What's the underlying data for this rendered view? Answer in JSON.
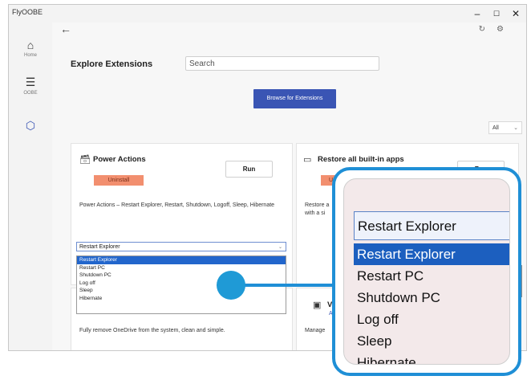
{
  "window": {
    "title": "FlyOOBE",
    "controls": [
      "–",
      "☐",
      "✕"
    ]
  },
  "sidebar": {
    "items": [
      {
        "glyph": "⌂",
        "label": "Home",
        "icon": "home-icon"
      },
      {
        "glyph": "☰",
        "label": "OOBE",
        "icon": "list-icon"
      },
      {
        "glyph": "⬡",
        "label": "",
        "icon": "puzzle-icon"
      }
    ]
  },
  "header": {
    "back": "←",
    "refresh": "↻",
    "settings": "⚙"
  },
  "page": {
    "title": "Explore Extensions",
    "search_value": "Search",
    "browse_label": "Browse for Extensions",
    "filter_value": "All"
  },
  "cards": {
    "power": {
      "title": "Power Actions",
      "uninstall": "Uninstall",
      "run": "Run",
      "description": "Power Actions – Restart Explorer, Restart, Shutdown, Logoff, Sleep, Hibernate",
      "selected": "Restart Explorer",
      "options": [
        "Restart Explorer",
        "Restart PC",
        "Shutdown PC",
        "Log off",
        "Sleep",
        "Hibernate"
      ]
    },
    "restore": {
      "title": "Restore all built-in apps",
      "uninstall": "Unin",
      "run": "Run",
      "description_line1": "Restore a",
      "description_line2": "with a si"
    },
    "onedrive": {
      "description": "Fully remove OneDrive from the system, clean and simple."
    },
    "fourth": {
      "title_partial": "Vi",
      "badge_partial": "Ab",
      "description_partial": "Manage"
    }
  },
  "magnifier": {
    "selected": "Restart Explorer",
    "options": [
      "Restart Explorer",
      "Restart PC",
      "Shutdown PC",
      "Log off",
      "Sleep",
      "Hibernate"
    ]
  },
  "colors": {
    "accent": "#3a55b4",
    "uninstall": "#f28f6f",
    "highlight": "#2266cc",
    "callout": "#1f8fd6"
  }
}
